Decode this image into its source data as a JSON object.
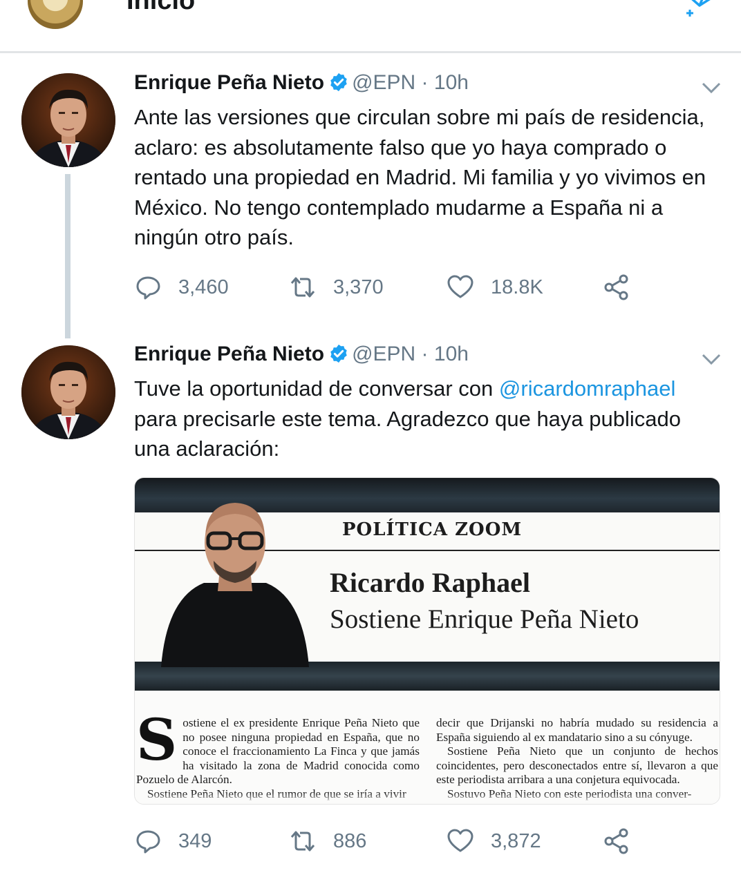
{
  "header": {
    "title": "Inicio"
  },
  "tweets": [
    {
      "author": {
        "name": "Enrique Peña Nieto",
        "handle": "@EPN",
        "separator": "·",
        "time": "10h"
      },
      "text": "Ante las versiones que circulan sobre mi país de residencia, aclaro: es absolutamente falso que yo haya comprado o rentado una propiedad en Madrid. Mi familia y yo vivimos en México. No tengo contemplado mudarme a España ni a ningún otro país.",
      "stats": {
        "replies": "3,460",
        "retweets": "3,370",
        "likes": "18.8K"
      }
    },
    {
      "author": {
        "name": "Enrique Peña Nieto",
        "handle": "@EPN",
        "separator": "·",
        "time": "10h"
      },
      "text_before": "Tuve la oportunidad de conversar con ",
      "mention": "@ricardomraphael",
      "text_after": " para precisarle este tema. Agradezco que haya publicado una aclaración:",
      "stats": {
        "replies": "349",
        "retweets": "886",
        "likes": "3,872"
      },
      "media": {
        "section": "POLÍTICA ZOOM",
        "author": "Ricardo Raphael",
        "headline": "Sostiene Enrique Peña Nieto",
        "dropcap": "S",
        "col1_first": "ostiene el ex presidente Enrique Peña Nieto que no posee ninguna propiedad en España, que no conoce el fraccionamiento La Finca y que jamás ha visitado la zona de Madrid conocida como Pozuelo de Alarcón.",
        "col1_second": "Sostiene Peña Nieto que el rumor de que se iría a vivir",
        "col2_first": "decir que Drijanski no habría mudado su residencia a España siguiendo al ex mandatario sino a su cónyuge.",
        "col2_second": "Sostiene Peña Nieto que un conjunto de hechos coincidentes, pero desconectados entre sí, llevaron a que este periodista arribara a una conjetura equivocada.",
        "col2_third": "Sostuvo Peña Nieto con este periodista una conver-"
      }
    }
  ],
  "colors": {
    "accent": "#1da1f2",
    "mention": "#1b95e0",
    "muted": "#657786"
  },
  "icons": [
    "compose-icon",
    "verified-badge-icon",
    "chevron-down-icon",
    "reply-icon",
    "retweet-icon",
    "like-icon",
    "share-icon"
  ]
}
